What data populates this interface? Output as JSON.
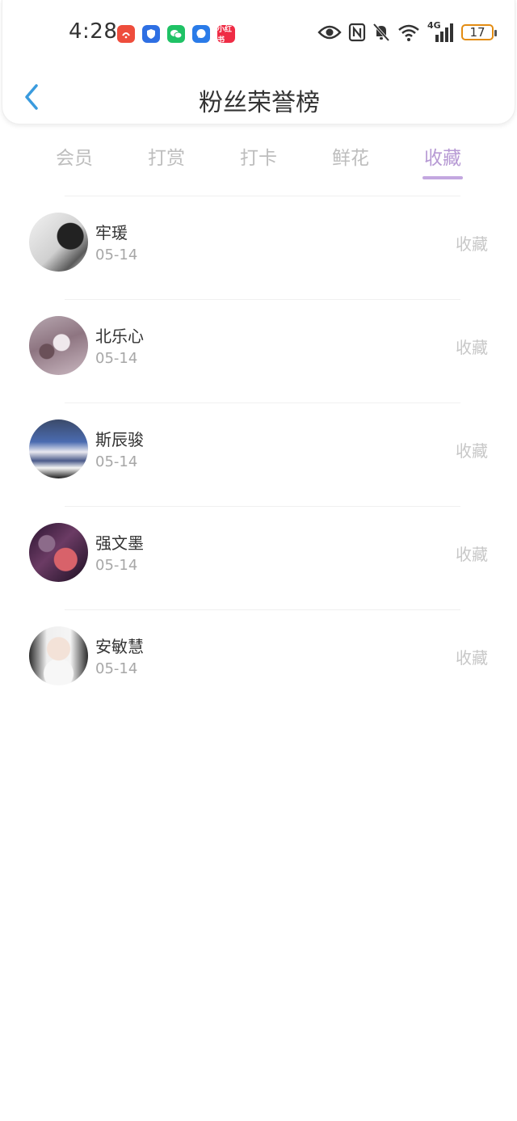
{
  "status_bar": {
    "time": "4:28",
    "battery_level": "17",
    "network_label": "4G",
    "notification_icons": [
      "alert-app-icon",
      "shield-app-icon",
      "wechat-icon",
      "message-icon",
      "xiaohongshu-icon"
    ],
    "xiaohongshu_text": "小红书",
    "battery_color": "#e38c12"
  },
  "header": {
    "title": "粉丝荣誉榜",
    "back_icon": "chevron-left-icon"
  },
  "tabs": [
    {
      "label": "会员",
      "active": false
    },
    {
      "label": "打赏",
      "active": false
    },
    {
      "label": "打卡",
      "active": false
    },
    {
      "label": "鲜花",
      "active": false
    },
    {
      "label": "收藏",
      "active": true
    }
  ],
  "colors": {
    "accent": "#b79ad4",
    "back_arrow": "#3a9bde",
    "muted": "#bdbdbd"
  },
  "fans": [
    {
      "name": "牢瑗",
      "date": "05-14",
      "action": "收藏"
    },
    {
      "name": "北乐心",
      "date": "05-14",
      "action": "收藏"
    },
    {
      "name": "斯辰骏",
      "date": "05-14",
      "action": "收藏"
    },
    {
      "name": "强文墨",
      "date": "05-14",
      "action": "收藏"
    },
    {
      "name": "安敏慧",
      "date": "05-14",
      "action": "收藏"
    }
  ]
}
